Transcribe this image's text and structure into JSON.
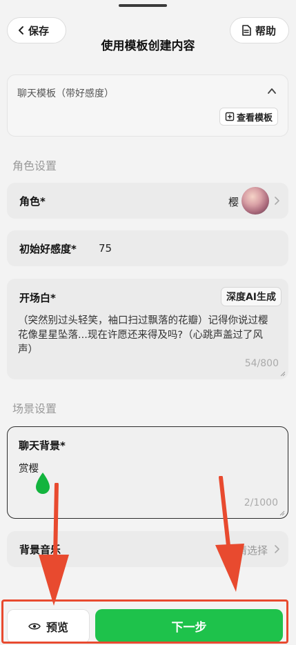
{
  "header": {
    "save_label": "保存",
    "title": "使用模板创建内容",
    "help_label": "帮助"
  },
  "template": {
    "name": "聊天模板（带好感度）",
    "view_label": "查看模板"
  },
  "role_section": {
    "title": "角色设置",
    "role_label": "角色*",
    "role_name": "樱",
    "affection_label": "初始好感度*",
    "affection_value": "75",
    "opening_label": "开场白*",
    "ai_generate_label": "深度AI生成",
    "opening_text": "（突然别过头轻笑，袖口扫过飘落的花瓣）记得你说过樱花像星星坠落...现在许愿还来得及吗?（心跳声盖过了风声）",
    "opening_counter": "54/800"
  },
  "scene_section": {
    "title": "场景设置",
    "bg_label": "聊天背景*",
    "bg_value": "赏樱",
    "bg_counter": "2/1000",
    "music_label": "背景音乐",
    "music_placeholder": "请选择"
  },
  "footer": {
    "preview_label": "预览",
    "next_label": "下一步"
  },
  "colors": {
    "primary_green": "#1ec24b",
    "annotation_red": "#e84a2f"
  }
}
